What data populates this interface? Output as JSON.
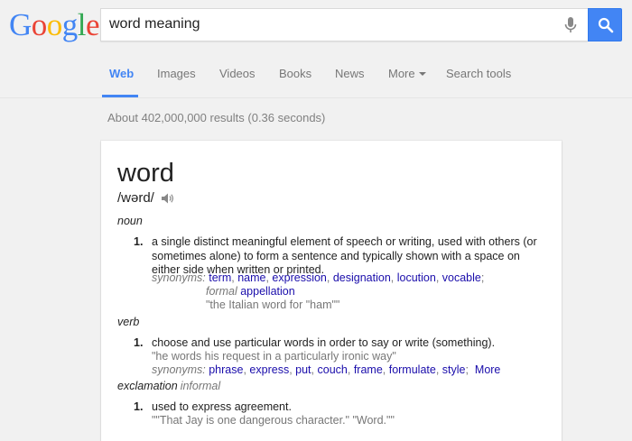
{
  "logo": {
    "letters": [
      "G",
      "o",
      "o",
      "g",
      "l",
      "e"
    ]
  },
  "search": {
    "query": "word meaning"
  },
  "icons": {
    "mic": "microphone-icon",
    "search": "search-icon",
    "speaker": "speaker-icon"
  },
  "colors": {
    "accent": "#4285f4",
    "link": "#1a0dab",
    "muted": "#777777"
  },
  "tabs": [
    {
      "label": "Web",
      "active": true
    },
    {
      "label": "Images"
    },
    {
      "label": "Videos"
    },
    {
      "label": "Books"
    },
    {
      "label": "News"
    },
    {
      "label": "More"
    },
    {
      "label": "Search tools"
    }
  ],
  "stats": "About 402,000,000 results (0.36 seconds)",
  "dictionary": {
    "word": "word",
    "phonetic": "/wərd/",
    "noun": {
      "pos": "noun",
      "number": "1.",
      "definition": "a single distinct meaningful element of speech or writing, used with others (or sometimes alone) to form a sentence and typically shown with a space on either side when written or printed.",
      "synonyms_label": "synonyms:",
      "synonyms": [
        "term",
        "name",
        "expression",
        "designation",
        "locution",
        "vocable"
      ],
      "formal_label": "formal",
      "formal_word": "appellation",
      "example": "\"the Italian word for \"ham\"\""
    },
    "verb": {
      "pos": "verb",
      "number": "1.",
      "definition": "choose and use particular words in order to say or write (something).",
      "example": "\"he words his request in a particularly ironic way\"",
      "synonyms_label": "synonyms:",
      "synonyms": [
        "phrase",
        "express",
        "put",
        "couch",
        "frame",
        "formulate",
        "style"
      ],
      "more": "More"
    },
    "exclamation": {
      "pos": "exclamation",
      "register": "informal",
      "number": "1.",
      "definition": "used to express agreement.",
      "example": "\"\"That Jay is one dangerous character.\" \"Word.\"\""
    }
  }
}
